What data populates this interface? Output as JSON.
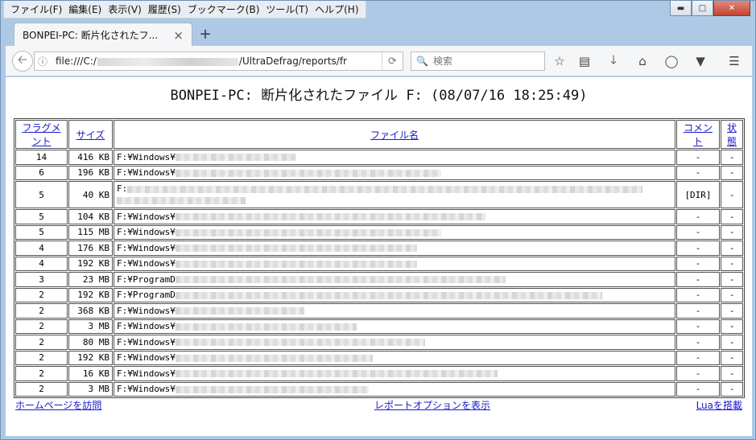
{
  "menubar": [
    "ファイル(F)",
    "編集(E)",
    "表示(V)",
    "履歴(S)",
    "ブックマーク(B)",
    "ツール(T)",
    "ヘルプ(H)"
  ],
  "tab": {
    "title": "BONPEI-PC: 断片化されたフ...",
    "close": "×",
    "new": "+"
  },
  "navbar": {
    "url_prefix": "file:///C:/",
    "url_suffix": "/UltraDefrag/reports/fr",
    "search_placeholder": "検索"
  },
  "report": {
    "title": "BONPEI-PC: 断片化されたファイル F: (08/07/16 18:25:49)",
    "headers": {
      "fragments": "フラグメント",
      "size": "サイズ",
      "filename": "ファイル名",
      "comment": "コメント",
      "status": "状態"
    },
    "rows": [
      {
        "fragments": "14",
        "size": "416 KB",
        "path": "F:¥Windows¥",
        "comment": "-",
        "status": "-"
      },
      {
        "fragments": "6",
        "size": "196 KB",
        "path": "F:¥Windows¥",
        "comment": "-",
        "status": "-"
      },
      {
        "fragments": "5",
        "size": "40 KB",
        "path": "F:",
        "comment": "[DIR]",
        "status": "-"
      },
      {
        "fragments": "5",
        "size": "104 KB",
        "path": "F:¥Windows¥",
        "comment": "-",
        "status": "-"
      },
      {
        "fragments": "5",
        "size": "115 MB",
        "path": "F:¥Windows¥",
        "comment": "-",
        "status": "-"
      },
      {
        "fragments": "4",
        "size": "176 KB",
        "path": "F:¥Windows¥",
        "comment": "-",
        "status": "-"
      },
      {
        "fragments": "4",
        "size": "192 KB",
        "path": "F:¥Windows¥",
        "comment": "-",
        "status": "-"
      },
      {
        "fragments": "3",
        "size": "23 MB",
        "path": "F:¥ProgramD",
        "comment": "-",
        "status": "-"
      },
      {
        "fragments": "2",
        "size": "192 KB",
        "path": "F:¥ProgramD",
        "comment": "-",
        "status": "-"
      },
      {
        "fragments": "2",
        "size": "368 KB",
        "path": "F:¥Windows¥",
        "comment": "-",
        "status": "-"
      },
      {
        "fragments": "2",
        "size": "3 MB",
        "path": "F:¥Windows¥",
        "comment": "-",
        "status": "-"
      },
      {
        "fragments": "2",
        "size": "80 MB",
        "path": "F:¥Windows¥",
        "comment": "-",
        "status": "-"
      },
      {
        "fragments": "2",
        "size": "192 KB",
        "path": "F:¥Windows¥",
        "comment": "-",
        "status": "-"
      },
      {
        "fragments": "2",
        "size": "16 KB",
        "path": "F:¥Windows¥",
        "comment": "-",
        "status": "-"
      },
      {
        "fragments": "2",
        "size": "3 MB",
        "path": "F:¥Windows¥",
        "comment": "-",
        "status": "-"
      }
    ]
  },
  "links": {
    "home": "ホームページを訪問",
    "options": "レポートオプションを表示",
    "lua": "Luaを搭載"
  }
}
